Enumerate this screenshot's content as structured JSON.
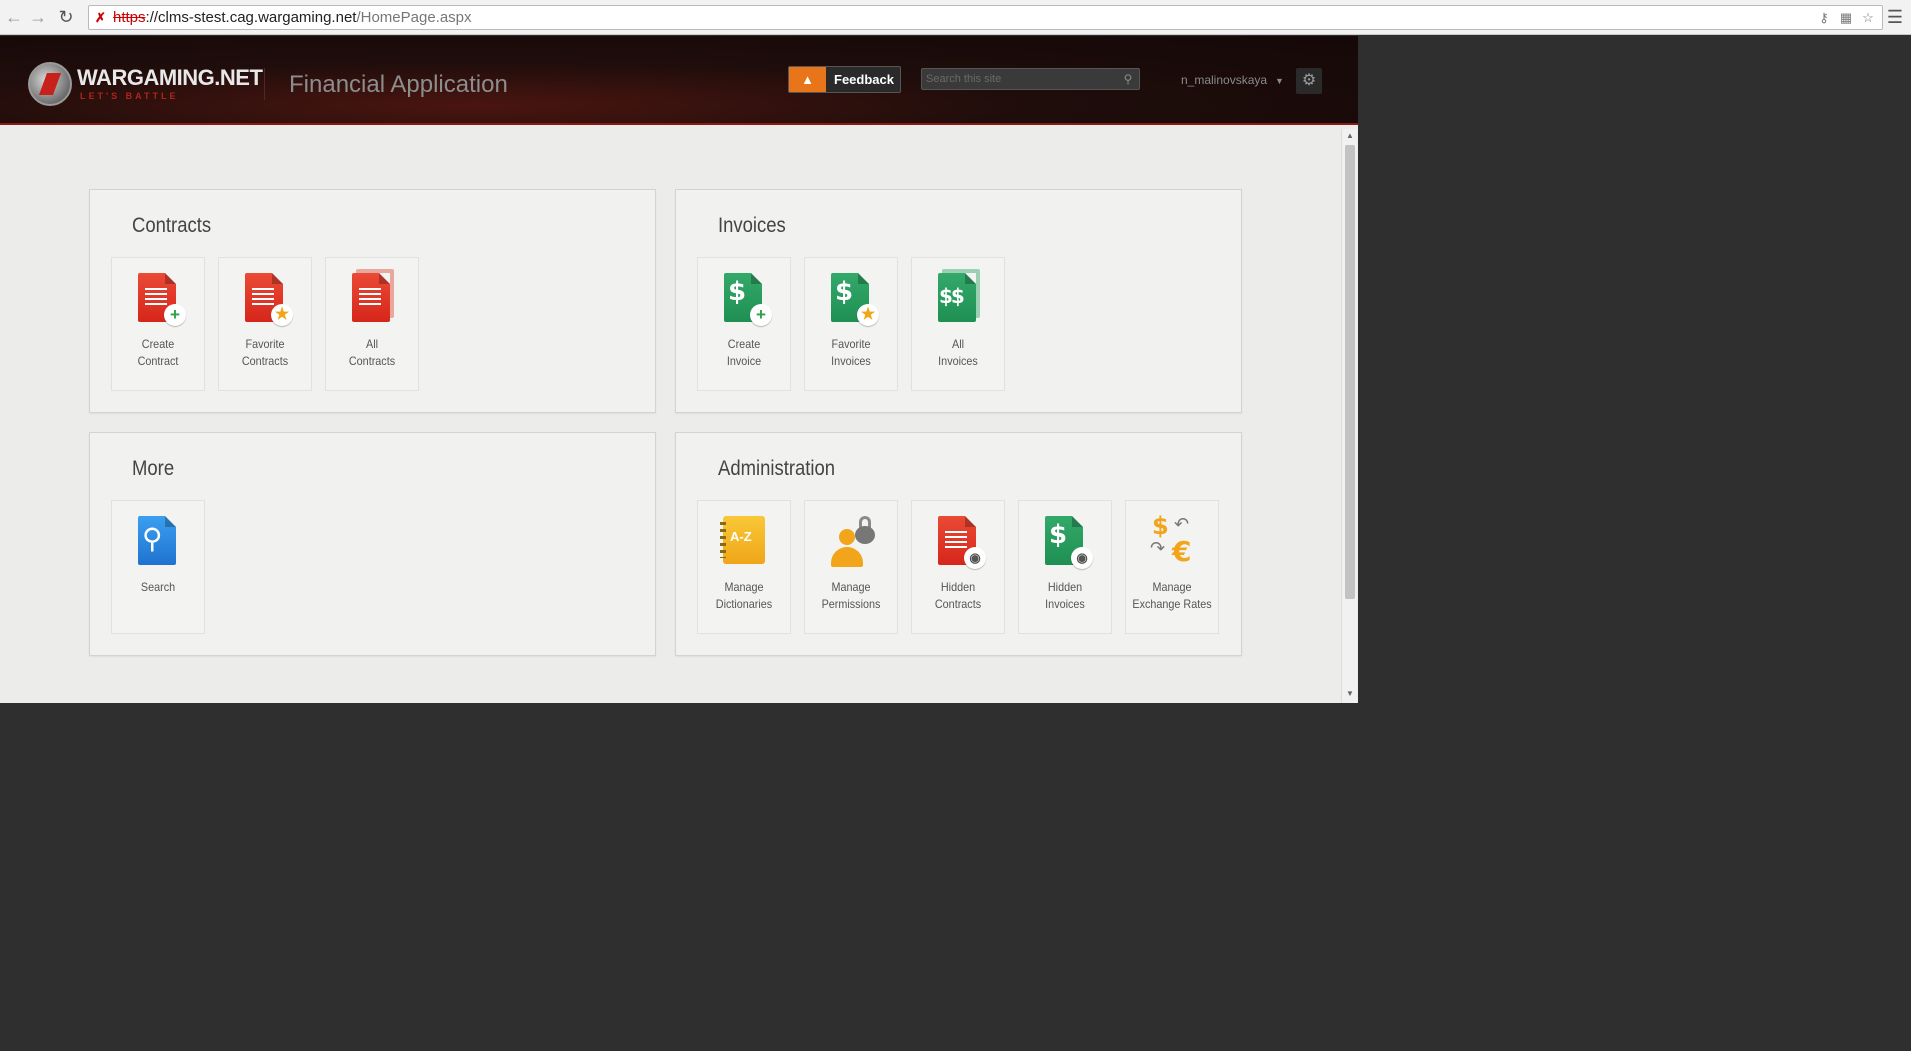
{
  "browser": {
    "url_protocol": "https",
    "url_separator": "://",
    "url_host": "clms-stest.cag.wargaming.net",
    "url_path": "/HomePage.aspx"
  },
  "header": {
    "logo_text": "WARGAMING.NET",
    "logo_subtext": "LET'S BATTLE",
    "app_title": "Financial Application",
    "feedback_label": "Feedback",
    "search_placeholder": "Search this site",
    "username": "n_malinovskaya"
  },
  "panels": {
    "contracts": {
      "title": "Contracts",
      "tiles": [
        {
          "line1": "Create",
          "line2": "Contract",
          "icon": "create-contract-icon"
        },
        {
          "line1": "Favorite",
          "line2": "Contracts",
          "icon": "favorite-contracts-icon"
        },
        {
          "line1": "All",
          "line2": "Contracts",
          "icon": "all-contracts-icon"
        }
      ]
    },
    "invoices": {
      "title": "Invoices",
      "tiles": [
        {
          "line1": "Create",
          "line2": "Invoice",
          "icon": "create-invoice-icon"
        },
        {
          "line1": "Favorite",
          "line2": "Invoices",
          "icon": "favorite-invoices-icon"
        },
        {
          "line1": "All",
          "line2": "Invoices",
          "icon": "all-invoices-icon"
        }
      ]
    },
    "more": {
      "title": "More",
      "tiles": [
        {
          "line1": "Search",
          "line2": "",
          "icon": "search-icon"
        }
      ]
    },
    "administration": {
      "title": "Administration",
      "tiles": [
        {
          "line1": "Manage",
          "line2": "Dictionaries",
          "icon": "dictionary-icon"
        },
        {
          "line1": "Manage",
          "line2": "Permissions",
          "icon": "permissions-icon"
        },
        {
          "line1": "Hidden",
          "line2": "Contracts",
          "icon": "hidden-contracts-icon"
        },
        {
          "line1": "Hidden",
          "line2": "Invoices",
          "icon": "hidden-invoices-icon"
        },
        {
          "line1": "Manage",
          "line2": "Exchange Rates",
          "icon": "exchange-rates-icon"
        }
      ]
    }
  },
  "colors": {
    "contracts_red": "#d6261b",
    "invoices_green": "#1f8f52",
    "search_blue": "#1f73d0",
    "admin_amber": "#f2a51a",
    "header_accent": "#8c1a12"
  }
}
